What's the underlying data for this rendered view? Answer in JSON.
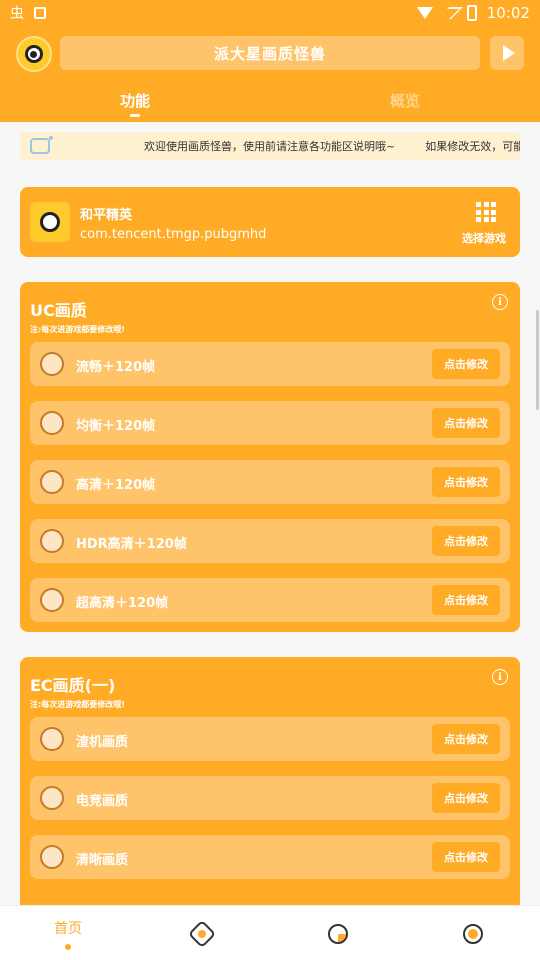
{
  "status_bar": {
    "time": "10:02",
    "left_glyph": "虫"
  },
  "header": {
    "title": "派大星画质怪兽",
    "tabs": [
      {
        "label": "功能"
      },
      {
        "label": "概览"
      }
    ]
  },
  "notice": {
    "message": "欢迎使用画质怪兽，使用前请注意各功能区说明哦~",
    "message2": "如果修改无效，可能"
  },
  "game": {
    "name": "和平精英",
    "package": "com.tencent.tmgp.pubgmhd",
    "select_label": "选择游戏"
  },
  "uc": {
    "title": "UC画质",
    "note": "注:每次进游戏都要修改哦!",
    "items": [
      {
        "label": "流畅＋120帧",
        "button": "点击修改",
        "icon": "mouse-icon"
      },
      {
        "label": "均衡＋120帧",
        "button": "点击修改",
        "icon": "cow-icon"
      },
      {
        "label": "高清＋120帧",
        "button": "点击修改",
        "icon": "tiger-icon"
      },
      {
        "label": "HDR高清＋120帧",
        "button": "点击修改",
        "icon": "rabbit-icon"
      },
      {
        "label": "超高清＋120帧",
        "button": "点击修改",
        "icon": "dragon-icon"
      }
    ]
  },
  "ec": {
    "title": "EC画质(一)",
    "note": "注:每次进游戏都要修改哦!",
    "items": [
      {
        "label": "渣机画质",
        "button": "点击修改",
        "icon": "snake-icon"
      },
      {
        "label": "电竞画质",
        "button": "点击修改",
        "icon": "horse-icon"
      },
      {
        "label": "清晰画质",
        "button": "点击修改",
        "icon": "goat-icon"
      }
    ]
  },
  "bottom_nav": {
    "home_label": "首页"
  },
  "colors": {
    "accent": "#ffab25",
    "accent_light": "#ffc36a",
    "notice_bg": "#fff0d0"
  }
}
